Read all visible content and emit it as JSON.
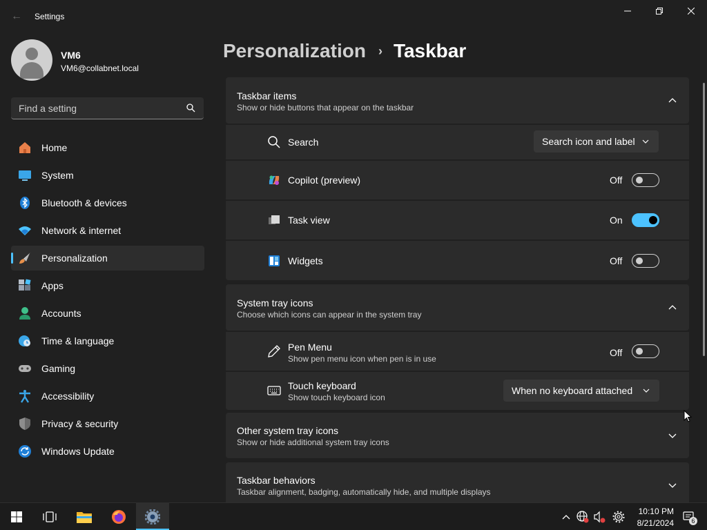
{
  "window": {
    "title": "Settings",
    "back_glyph": "←"
  },
  "profile": {
    "name": "VM6",
    "email": "VM6@collabnet.local"
  },
  "search": {
    "placeholder": "Find a setting"
  },
  "sidebar": {
    "items": [
      {
        "label": "Home",
        "icon": "home-icon"
      },
      {
        "label": "System",
        "icon": "system-icon"
      },
      {
        "label": "Bluetooth & devices",
        "icon": "bluetooth-icon"
      },
      {
        "label": "Network & internet",
        "icon": "wifi-icon"
      },
      {
        "label": "Personalization",
        "icon": "brush-icon",
        "selected": true
      },
      {
        "label": "Apps",
        "icon": "apps-icon"
      },
      {
        "label": "Accounts",
        "icon": "accounts-icon"
      },
      {
        "label": "Time & language",
        "icon": "time-language-icon"
      },
      {
        "label": "Gaming",
        "icon": "gamepad-icon"
      },
      {
        "label": "Accessibility",
        "icon": "accessibility-icon"
      },
      {
        "label": "Privacy & security",
        "icon": "shield-icon"
      },
      {
        "label": "Windows Update",
        "icon": "update-icon"
      }
    ]
  },
  "header": {
    "parent": "Personalization",
    "separator": "›",
    "current": "Taskbar"
  },
  "taskbar_items": {
    "title": "Taskbar items",
    "subtitle": "Show or hide buttons that appear on the taskbar",
    "expanded": true,
    "rows": [
      {
        "label": "Search",
        "control": "dropdown",
        "value": "Search icon and label",
        "icon": "search-icon"
      },
      {
        "label": "Copilot (preview)",
        "control": "toggle",
        "state": "Off",
        "on": false,
        "icon": "copilot-icon"
      },
      {
        "label": "Task view",
        "control": "toggle",
        "state": "On",
        "on": true,
        "icon": "task-view-icon"
      },
      {
        "label": "Widgets",
        "control": "toggle",
        "state": "Off",
        "on": false,
        "icon": "widgets-icon"
      }
    ]
  },
  "system_tray": {
    "title": "System tray icons",
    "subtitle": "Choose which icons can appear in the system tray",
    "expanded": true,
    "rows": [
      {
        "label": "Pen Menu",
        "sub": "Show pen menu icon when pen is in use",
        "control": "toggle",
        "state": "Off",
        "on": false,
        "icon": "pen-icon"
      },
      {
        "label": "Touch keyboard",
        "sub": "Show touch keyboard icon",
        "control": "dropdown",
        "value": "When no keyboard attached",
        "icon": "keyboard-icon"
      }
    ]
  },
  "other_tray": {
    "title": "Other system tray icons",
    "subtitle": "Show or hide additional system tray icons",
    "expanded": false
  },
  "behaviors": {
    "title": "Taskbar behaviors",
    "subtitle": "Taskbar alignment, badging, automatically hide, and multiple displays",
    "expanded": false
  },
  "taskbar": {
    "apps": [
      "start-icon",
      "task-view-icon",
      "file-explorer-icon",
      "firefox-icon",
      "settings-icon"
    ],
    "time": "10:10 PM",
    "date": "8/21/2024",
    "notification_count": "6"
  },
  "colors": {
    "accent": "#4cc2ff",
    "background": "#202020",
    "card": "#2b2b2b"
  }
}
